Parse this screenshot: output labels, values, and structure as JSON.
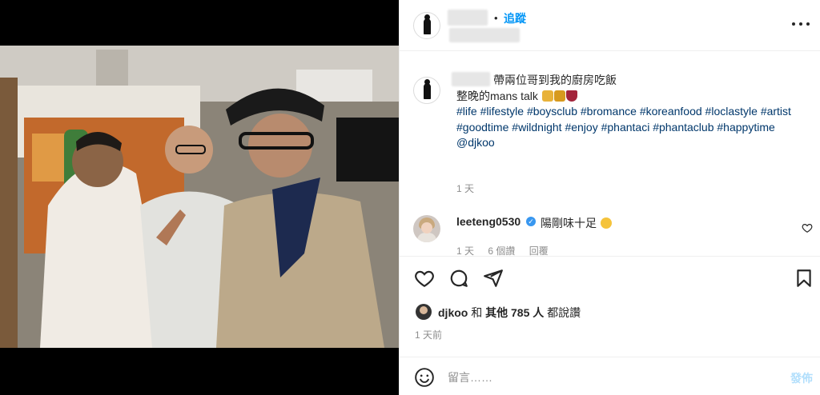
{
  "header": {
    "separator": "•",
    "follow_label": "追蹤",
    "more_icon": "more-horizontal-icon"
  },
  "caption": {
    "line1": "帶兩位哥到我的廚房吃飯",
    "line2": "整晚的mans talk",
    "emojis": [
      "beer-emoji",
      "beer-emoji",
      "wine-emoji"
    ],
    "hashtags": [
      "#life",
      "#lifestyle",
      "#boysclub",
      "#bromance",
      "#koreanfood",
      "#loclastyle",
      "#artist",
      "#goodtime",
      "#wildnight",
      "#enjoy",
      "#phantaci",
      "#phantaclub",
      "#happytime"
    ],
    "mention": "@djkoo",
    "time": "1 天"
  },
  "comment": {
    "username": "leeteng0530",
    "verified_icon": "verified-badge-icon",
    "text": "陽剛味十足",
    "emoji": "grin-emoji",
    "time": "1 天",
    "likes": "6 個讚",
    "reply": "回覆"
  },
  "actions": {
    "icons": [
      "heart-icon",
      "comment-icon",
      "share-icon",
      "bookmark-icon"
    ]
  },
  "likes": {
    "user": "djkoo",
    "and": "和",
    "others": "其他 785 人",
    "suffix": "都說讚"
  },
  "post_time": "1 天前",
  "composer": {
    "placeholder": "留言……",
    "post_label": "發佈"
  },
  "colors": {
    "link_blue": "#0095f6",
    "hashtag": "#00376b",
    "muted": "#8e8e8e",
    "post_disabled": "#b2dffc"
  }
}
